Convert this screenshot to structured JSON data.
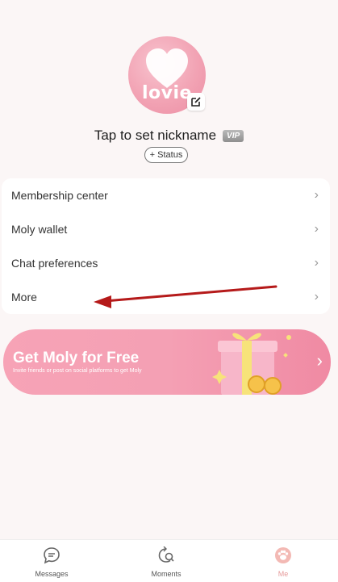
{
  "profile": {
    "avatar_text": "lovie",
    "nickname": "Tap to set nickname",
    "vip_badge": "VIP",
    "status_button": "+ Status"
  },
  "menu": {
    "items": [
      {
        "label": "Membership center"
      },
      {
        "label": "Moly wallet"
      },
      {
        "label": "Chat preferences"
      },
      {
        "label": "More"
      }
    ]
  },
  "promo": {
    "title": "Get Moly for Free",
    "subtitle": "Invite friends or post on social platforms to get Moly"
  },
  "bottom_nav": {
    "tabs": [
      {
        "label": "Messages",
        "icon": "chat-bubble-icon"
      },
      {
        "label": "Moments",
        "icon": "moments-icon"
      },
      {
        "label": "Me",
        "icon": "paw-icon",
        "active": true
      }
    ]
  },
  "colors": {
    "accent_pink": "#f4a0b4",
    "active_tab": "#e69a9a",
    "annotation_arrow": "#b51a1a"
  }
}
